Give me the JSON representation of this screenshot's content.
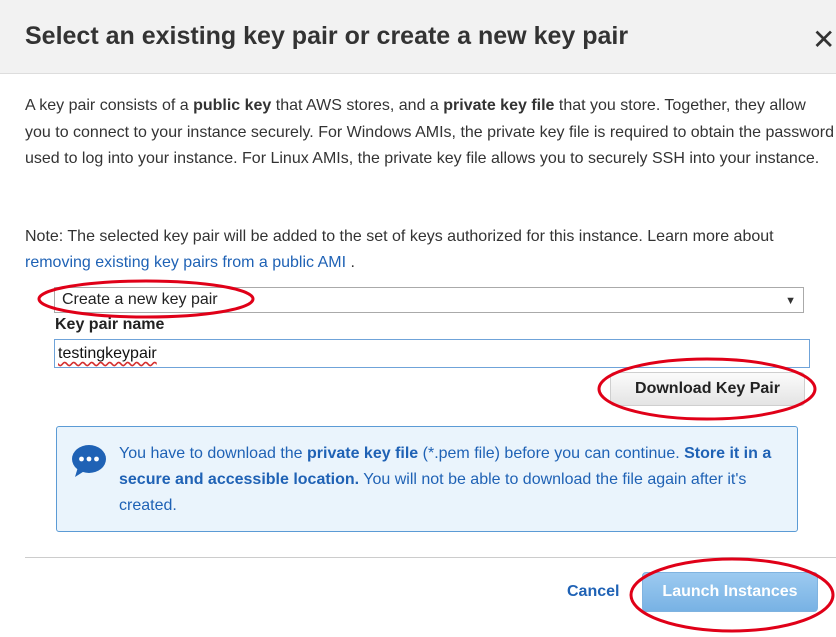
{
  "dialog": {
    "title": "Select an existing key pair or create a new key pair",
    "close_label": "✕"
  },
  "description": {
    "t1": "A key pair consists of a ",
    "b1": "public key",
    "t2": " that AWS stores, and a ",
    "b2": "private key file",
    "t3": " that you store. Together, they allow you to connect to your instance securely. For Windows AMIs, the private key file is required to obtain the password used to log into your instance. For Linux AMIs, the private key file allows you to securely SSH into your instance."
  },
  "note": {
    "text": "Note: The selected key pair will be added to the set of keys authorized for this instance. Learn more about ",
    "link": "removing existing key pairs from a public AMI",
    "end": " ."
  },
  "key_select": {
    "value": "Create a new key pair",
    "arrow": "▼"
  },
  "key_name": {
    "label": "Key pair name",
    "value": "testingkeypair"
  },
  "download_button": "Download Key Pair",
  "info": {
    "t1": "You have to download the ",
    "b1": "private key file",
    "t2": " (*.pem file) before you can continue. ",
    "b2": "Store it in a secure and accessible location.",
    "t3": " You will not be able to download the file again after it's created."
  },
  "footer": {
    "cancel": "Cancel",
    "launch": "Launch Instances"
  },
  "colors": {
    "accent": "#1f62b5",
    "annotation": "#e00018",
    "info_bg": "#eaf4fc",
    "launch_bg": "#78b2e4"
  }
}
